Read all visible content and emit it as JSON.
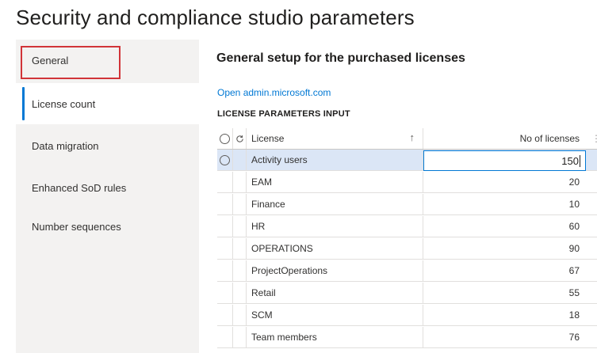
{
  "page": {
    "title": "Security and compliance studio parameters"
  },
  "sidebar": {
    "items": [
      {
        "label": "General"
      },
      {
        "label": "License count"
      },
      {
        "label": "Data migration"
      },
      {
        "label": "Enhanced SoD rules"
      },
      {
        "label": "Number sequences"
      }
    ],
    "selected": "License count"
  },
  "main": {
    "section_title": "General setup for the purchased licenses",
    "admin_link": "Open admin.microsoft.com",
    "grid_caption": "LICENSE PARAMETERS INPUT",
    "columns": {
      "license": "License",
      "count": "No of licenses"
    },
    "rows": [
      {
        "license": "Activity users",
        "count": "150"
      },
      {
        "license": "EAM",
        "count": "20"
      },
      {
        "license": "Finance",
        "count": "10"
      },
      {
        "license": "HR",
        "count": "60"
      },
      {
        "license": "OPERATIONS",
        "count": "90"
      },
      {
        "license": "ProjectOperations",
        "count": "67"
      },
      {
        "license": "Retail",
        "count": "55"
      },
      {
        "license": "SCM",
        "count": "18"
      },
      {
        "license": "Team members",
        "count": "76"
      }
    ]
  },
  "colors": {
    "accent": "#0078d4",
    "highlight_border": "#d13438",
    "selected_row": "#dbe6f6",
    "sidebar_bg": "#f3f2f1"
  },
  "icons": {
    "sort": "sort-ascending-icon",
    "refresh": "refresh-icon",
    "select": "radio-icon"
  }
}
